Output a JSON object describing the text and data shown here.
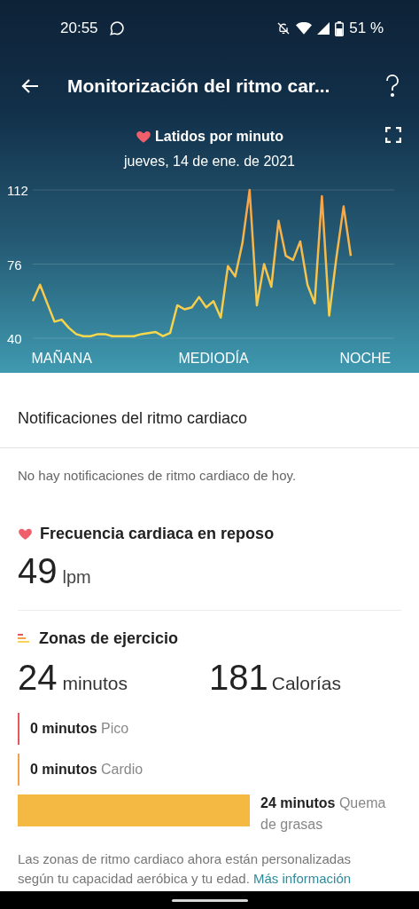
{
  "status_bar": {
    "time": "20:55",
    "battery": "51 %"
  },
  "app_bar": {
    "title": "Monitorización del ritmo car..."
  },
  "heart_chart": {
    "title": "Latidos por minuto",
    "date": "jueves, 14 de ene. de 2021",
    "chart_data": {
      "type": "line",
      "ylim": [
        40,
        112
      ],
      "yticks": [
        40,
        76,
        112
      ],
      "categories": [
        null,
        null,
        null,
        null,
        "MAÑANA",
        null,
        null,
        null,
        null,
        null,
        null,
        null,
        null,
        null,
        null,
        null,
        null,
        null,
        null,
        null,
        null,
        null,
        null,
        null,
        null,
        "MEDIODÍA",
        null,
        null,
        null,
        null,
        null,
        null,
        null,
        null,
        null,
        null,
        null,
        null,
        null,
        null,
        null,
        null,
        null,
        null,
        null,
        null,
        "NOCHE",
        null,
        null,
        null,
        null
      ],
      "series": [
        {
          "color": "#f7d94c",
          "values": [
            58,
            66,
            57,
            48,
            49,
            45,
            42,
            41,
            41,
            42,
            42,
            41,
            41,
            41,
            41,
            42,
            42.5,
            43,
            41,
            42.5,
            56,
            54,
            55,
            60,
            55,
            58,
            50,
            75,
            70,
            86,
            112,
            56,
            76,
            65,
            97,
            80,
            78,
            87,
            66,
            57,
            109,
            51,
            79,
            104,
            80,
            null,
            null,
            null,
            null,
            null,
            null
          ]
        }
      ]
    }
  },
  "notifications": {
    "title": "Notificaciones del ritmo cardiaco",
    "message": "No hay notificaciones de ritmo cardiaco de hoy."
  },
  "resting_heart_rate": {
    "title": "Frecuencia cardiaca en reposo",
    "value": "49",
    "unit": "lpm"
  },
  "exercise_zones": {
    "title": "Zonas de ejercicio",
    "minutes_value": "24",
    "minutes_unit": "minutos",
    "calories_value": "181",
    "calories_unit": "Calorías",
    "zones": [
      {
        "amount": "0 minutos",
        "name": "Pico",
        "color": "#e8555f",
        "kind": "marker"
      },
      {
        "amount": "0 minutos",
        "name": "Cardio",
        "color": "#f3a04b",
        "kind": "marker"
      },
      {
        "amount": "24 minutos",
        "name": "Quema de grasas",
        "color": "#f4b942",
        "kind": "bar"
      }
    ],
    "note": "Las zonas de ritmo cardiaco ahora están personalizadas según tu capacidad aeróbica y tu edad.",
    "link": "Más información"
  }
}
